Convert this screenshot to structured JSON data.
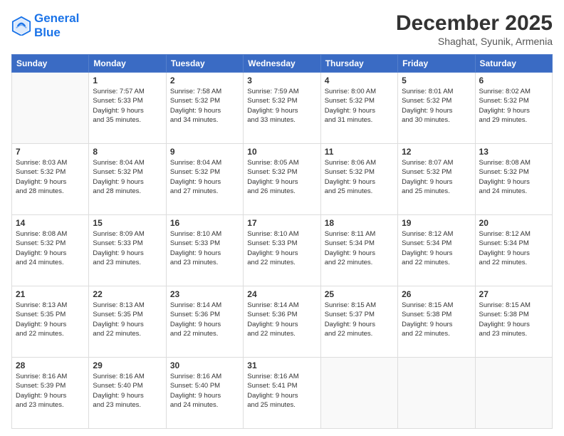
{
  "logo": {
    "line1": "General",
    "line2": "Blue"
  },
  "title": "December 2025",
  "subtitle": "Shaghat, Syunik, Armenia",
  "days_header": [
    "Sunday",
    "Monday",
    "Tuesday",
    "Wednesday",
    "Thursday",
    "Friday",
    "Saturday"
  ],
  "weeks": [
    [
      {
        "num": "",
        "info": ""
      },
      {
        "num": "1",
        "info": "Sunrise: 7:57 AM\nSunset: 5:33 PM\nDaylight: 9 hours\nand 35 minutes."
      },
      {
        "num": "2",
        "info": "Sunrise: 7:58 AM\nSunset: 5:32 PM\nDaylight: 9 hours\nand 34 minutes."
      },
      {
        "num": "3",
        "info": "Sunrise: 7:59 AM\nSunset: 5:32 PM\nDaylight: 9 hours\nand 33 minutes."
      },
      {
        "num": "4",
        "info": "Sunrise: 8:00 AM\nSunset: 5:32 PM\nDaylight: 9 hours\nand 31 minutes."
      },
      {
        "num": "5",
        "info": "Sunrise: 8:01 AM\nSunset: 5:32 PM\nDaylight: 9 hours\nand 30 minutes."
      },
      {
        "num": "6",
        "info": "Sunrise: 8:02 AM\nSunset: 5:32 PM\nDaylight: 9 hours\nand 29 minutes."
      }
    ],
    [
      {
        "num": "7",
        "info": "Sunrise: 8:03 AM\nSunset: 5:32 PM\nDaylight: 9 hours\nand 28 minutes."
      },
      {
        "num": "8",
        "info": "Sunrise: 8:04 AM\nSunset: 5:32 PM\nDaylight: 9 hours\nand 28 minutes."
      },
      {
        "num": "9",
        "info": "Sunrise: 8:04 AM\nSunset: 5:32 PM\nDaylight: 9 hours\nand 27 minutes."
      },
      {
        "num": "10",
        "info": "Sunrise: 8:05 AM\nSunset: 5:32 PM\nDaylight: 9 hours\nand 26 minutes."
      },
      {
        "num": "11",
        "info": "Sunrise: 8:06 AM\nSunset: 5:32 PM\nDaylight: 9 hours\nand 25 minutes."
      },
      {
        "num": "12",
        "info": "Sunrise: 8:07 AM\nSunset: 5:32 PM\nDaylight: 9 hours\nand 25 minutes."
      },
      {
        "num": "13",
        "info": "Sunrise: 8:08 AM\nSunset: 5:32 PM\nDaylight: 9 hours\nand 24 minutes."
      }
    ],
    [
      {
        "num": "14",
        "info": "Sunrise: 8:08 AM\nSunset: 5:32 PM\nDaylight: 9 hours\nand 24 minutes."
      },
      {
        "num": "15",
        "info": "Sunrise: 8:09 AM\nSunset: 5:33 PM\nDaylight: 9 hours\nand 23 minutes."
      },
      {
        "num": "16",
        "info": "Sunrise: 8:10 AM\nSunset: 5:33 PM\nDaylight: 9 hours\nand 23 minutes."
      },
      {
        "num": "17",
        "info": "Sunrise: 8:10 AM\nSunset: 5:33 PM\nDaylight: 9 hours\nand 22 minutes."
      },
      {
        "num": "18",
        "info": "Sunrise: 8:11 AM\nSunset: 5:34 PM\nDaylight: 9 hours\nand 22 minutes."
      },
      {
        "num": "19",
        "info": "Sunrise: 8:12 AM\nSunset: 5:34 PM\nDaylight: 9 hours\nand 22 minutes."
      },
      {
        "num": "20",
        "info": "Sunrise: 8:12 AM\nSunset: 5:34 PM\nDaylight: 9 hours\nand 22 minutes."
      }
    ],
    [
      {
        "num": "21",
        "info": "Sunrise: 8:13 AM\nSunset: 5:35 PM\nDaylight: 9 hours\nand 22 minutes."
      },
      {
        "num": "22",
        "info": "Sunrise: 8:13 AM\nSunset: 5:35 PM\nDaylight: 9 hours\nand 22 minutes."
      },
      {
        "num": "23",
        "info": "Sunrise: 8:14 AM\nSunset: 5:36 PM\nDaylight: 9 hours\nand 22 minutes."
      },
      {
        "num": "24",
        "info": "Sunrise: 8:14 AM\nSunset: 5:36 PM\nDaylight: 9 hours\nand 22 minutes."
      },
      {
        "num": "25",
        "info": "Sunrise: 8:15 AM\nSunset: 5:37 PM\nDaylight: 9 hours\nand 22 minutes."
      },
      {
        "num": "26",
        "info": "Sunrise: 8:15 AM\nSunset: 5:38 PM\nDaylight: 9 hours\nand 22 minutes."
      },
      {
        "num": "27",
        "info": "Sunrise: 8:15 AM\nSunset: 5:38 PM\nDaylight: 9 hours\nand 23 minutes."
      }
    ],
    [
      {
        "num": "28",
        "info": "Sunrise: 8:16 AM\nSunset: 5:39 PM\nDaylight: 9 hours\nand 23 minutes."
      },
      {
        "num": "29",
        "info": "Sunrise: 8:16 AM\nSunset: 5:40 PM\nDaylight: 9 hours\nand 23 minutes."
      },
      {
        "num": "30",
        "info": "Sunrise: 8:16 AM\nSunset: 5:40 PM\nDaylight: 9 hours\nand 24 minutes."
      },
      {
        "num": "31",
        "info": "Sunrise: 8:16 AM\nSunset: 5:41 PM\nDaylight: 9 hours\nand 25 minutes."
      },
      {
        "num": "",
        "info": ""
      },
      {
        "num": "",
        "info": ""
      },
      {
        "num": "",
        "info": ""
      }
    ]
  ]
}
